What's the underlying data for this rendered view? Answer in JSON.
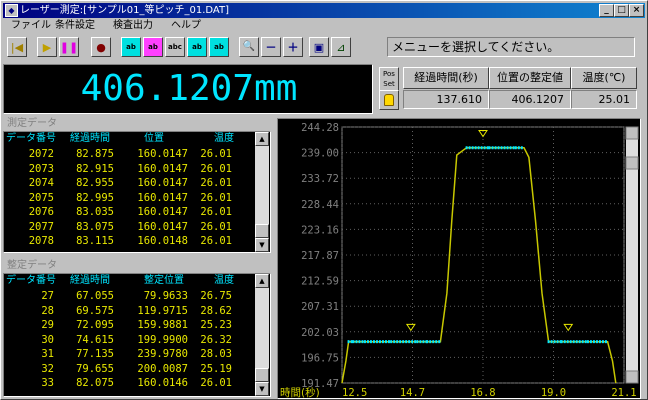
{
  "window": {
    "title": "レーザー測定:[サンプル01_等ピッチ_01.DAT]",
    "app_icon": "laser-app-icon",
    "buttons": {
      "minimize": "_",
      "maximize": "□",
      "close": "×"
    }
  },
  "menu": [
    "ファイル",
    "条件設定",
    "検査出力",
    "ヘルプ"
  ],
  "toolbar": {
    "buttons": [
      {
        "name": "rewind-icon",
        "glyph": "|◀"
      },
      {
        "name": "play-icon",
        "glyph": "▶"
      },
      {
        "name": "pause-icon",
        "glyph": "❚❚"
      },
      {
        "name": "record-stop-icon",
        "glyph": "●"
      },
      {
        "name": "mode1-icon",
        "glyph": "ab"
      },
      {
        "name": "mode2-icon",
        "glyph": "ab"
      },
      {
        "name": "mode3-icon",
        "glyph": "abc"
      },
      {
        "name": "mode4-icon",
        "glyph": "ab"
      },
      {
        "name": "mode5-icon",
        "glyph": "ab"
      },
      {
        "name": "zoom-icon",
        "glyph": "🔍"
      },
      {
        "name": "zoom-out-icon",
        "glyph": "－"
      },
      {
        "name": "zoom-in-icon",
        "glyph": "＋"
      },
      {
        "name": "camera-icon",
        "glyph": "▣"
      },
      {
        "name": "graph-icon",
        "glyph": "⊿"
      }
    ],
    "message": "メニューを選択してください。"
  },
  "readout": {
    "value": "406.1207mm",
    "reset_label": "Pos\nSet",
    "lock_icon": "lock-icon",
    "headers": {
      "elapsed": "経過時間(秒)",
      "settled": "位置の整定値",
      "temperature": "温度(℃)"
    },
    "values": {
      "elapsed": "137.610",
      "settled": "406.1207",
      "temperature": "25.01"
    }
  },
  "measured_panel": {
    "title": "測定データ",
    "columns": [
      "データ番号",
      "経過時間",
      "位置",
      "温度"
    ],
    "rows": [
      [
        "2072",
        "82.875",
        "160.0147",
        "26.01"
      ],
      [
        "2073",
        "82.915",
        "160.0147",
        "26.01"
      ],
      [
        "2074",
        "82.955",
        "160.0147",
        "26.01"
      ],
      [
        "2075",
        "82.995",
        "160.0147",
        "26.01"
      ],
      [
        "2076",
        "83.035",
        "160.0147",
        "26.01"
      ],
      [
        "2077",
        "83.075",
        "160.0147",
        "26.01"
      ],
      [
        "2078",
        "83.115",
        "160.0148",
        "26.01"
      ]
    ]
  },
  "settled_panel": {
    "title": "整定データ",
    "columns": [
      "データ番号",
      "経過時間",
      "整定位置",
      "温度"
    ],
    "rows": [
      [
        "27",
        "67.055",
        "79.9633",
        "26.75"
      ],
      [
        "28",
        "69.575",
        "119.9715",
        "28.62"
      ],
      [
        "29",
        "72.095",
        "159.9881",
        "25.23"
      ],
      [
        "30",
        "74.615",
        "199.9900",
        "26.32"
      ],
      [
        "31",
        "77.135",
        "239.9780",
        "28.03"
      ],
      [
        "32",
        "79.655",
        "200.0087",
        "25.19"
      ],
      [
        "33",
        "82.075",
        "160.0146",
        "26.01"
      ]
    ]
  },
  "colors": {
    "accent_cyan": "#00e5ff",
    "data_yellow": "#e8e800",
    "marker_cyan": "#00e5ff",
    "bg_black": "#000000"
  },
  "chart_data": {
    "type": "line",
    "title": "",
    "xlabel": "時間(秒)",
    "ylabel": "",
    "xlim": [
      12.5,
      21.1
    ],
    "ylim": [
      191.47,
      244.28
    ],
    "x_ticks": [
      "12.5",
      "14.7",
      "16.8",
      "19.0",
      "21.1"
    ],
    "y_ticks": [
      "244.28",
      "239.00",
      "233.72",
      "228.44",
      "223.16",
      "217.87",
      "212.59",
      "207.31",
      "202.03",
      "196.75",
      "191.47"
    ],
    "grid": true,
    "series": [
      {
        "x": [
          12.5,
          12.62,
          12.7,
          12.85,
          13.2,
          14.0,
          14.8,
          15.1,
          15.5,
          15.7,
          15.85,
          16.0,
          16.3,
          17.0,
          17.8,
          18.05,
          18.2,
          18.4,
          18.6,
          18.8,
          19.2,
          20.0,
          20.6,
          20.75,
          20.85
        ],
        "y": [
          191.47,
          196.0,
          200.0,
          200.0,
          200.0,
          200.0,
          200.0,
          200.0,
          200.0,
          210.0,
          225.0,
          238.5,
          240.0,
          240.0,
          240.0,
          240.0,
          238.0,
          225.0,
          210.0,
          200.0,
          200.0,
          200.0,
          200.0,
          196.0,
          191.47
        ]
      }
    ],
    "markers": [
      {
        "x": 14.6,
        "y": 201.5
      },
      {
        "x": 16.8,
        "y": 241.5
      },
      {
        "x": 19.4,
        "y": 201.5
      }
    ]
  }
}
